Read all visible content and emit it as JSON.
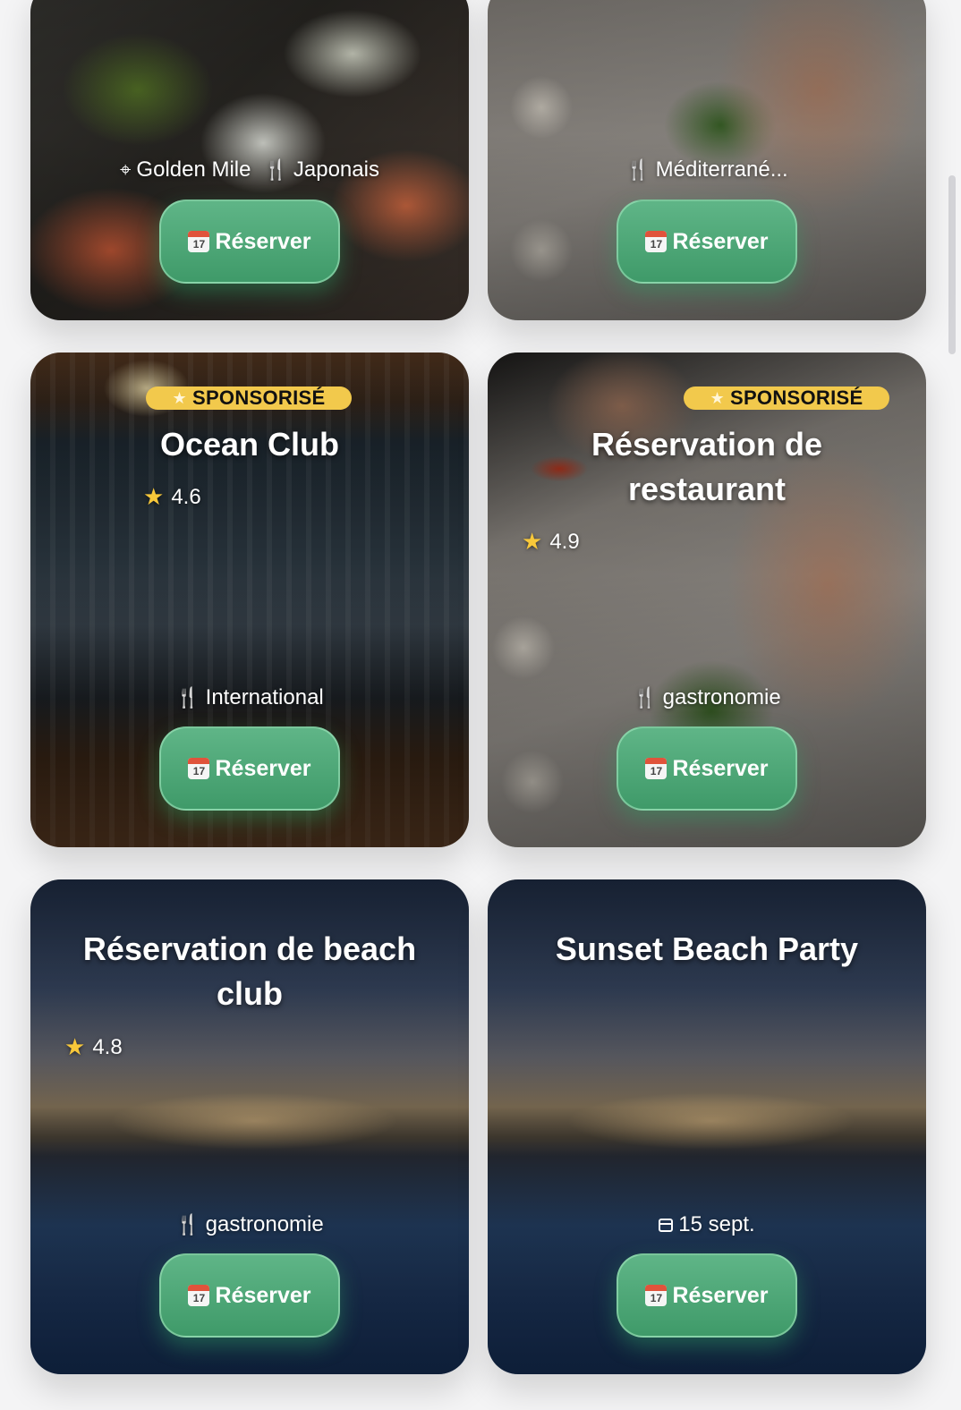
{
  "button_label": "Réserver",
  "cards": [
    {
      "location": "Golden Mile",
      "cuisine": "Japonais"
    },
    {
      "cuisine": "Méditerrané..."
    },
    {
      "badge": "SPONSORISÉ",
      "title": "Ocean Club",
      "rating": "4.6",
      "cuisine": "International"
    },
    {
      "badge": "SPONSORISÉ",
      "title_line1": "Réservation de",
      "title_line2": "restaurant",
      "rating": "4.9",
      "cuisine": "gastronomie"
    },
    {
      "title_line1": "Réservation de beach",
      "title_line2": "club",
      "rating": "4.8",
      "cuisine": "gastronomie"
    },
    {
      "title": "Sunset Beach Party",
      "date": "15 sept."
    }
  ],
  "icons": {
    "location": "map-pin-icon",
    "cuisine": "fork-knife-icon",
    "date": "calendar-icon",
    "rating": "star-icon",
    "button": "calendar-emoji-icon"
  },
  "colors": {
    "button": "#4fa877",
    "badge": "#f2c94c",
    "star": "#f8c83a"
  }
}
